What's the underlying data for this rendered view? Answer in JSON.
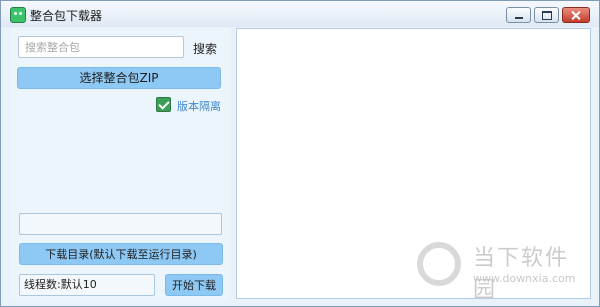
{
  "window": {
    "title": "整合包下载器",
    "icons": {
      "app": "app-icon",
      "minimize": "minimize-icon",
      "maximize": "maximize-icon",
      "close": "close-icon"
    }
  },
  "left": {
    "search_placeholder": "搜索整合包",
    "search_label": "搜索",
    "select_zip_label": "选择整合包ZIP",
    "version_isolation_label": "版本隔离",
    "version_isolation_checked": true,
    "download_dir_label": "下载目录(默认下载至运行目录)",
    "threads_value": "线程数:默认10",
    "start_download_label": "开始下载"
  },
  "watermark": {
    "text": "当下软件园",
    "url": "www.downxia.com"
  },
  "colors": {
    "button_bg": "#8ec9f5",
    "checkbox": "#3c9e58",
    "label_blue": "#3c89c9",
    "close_btn": "#c33c2a"
  }
}
